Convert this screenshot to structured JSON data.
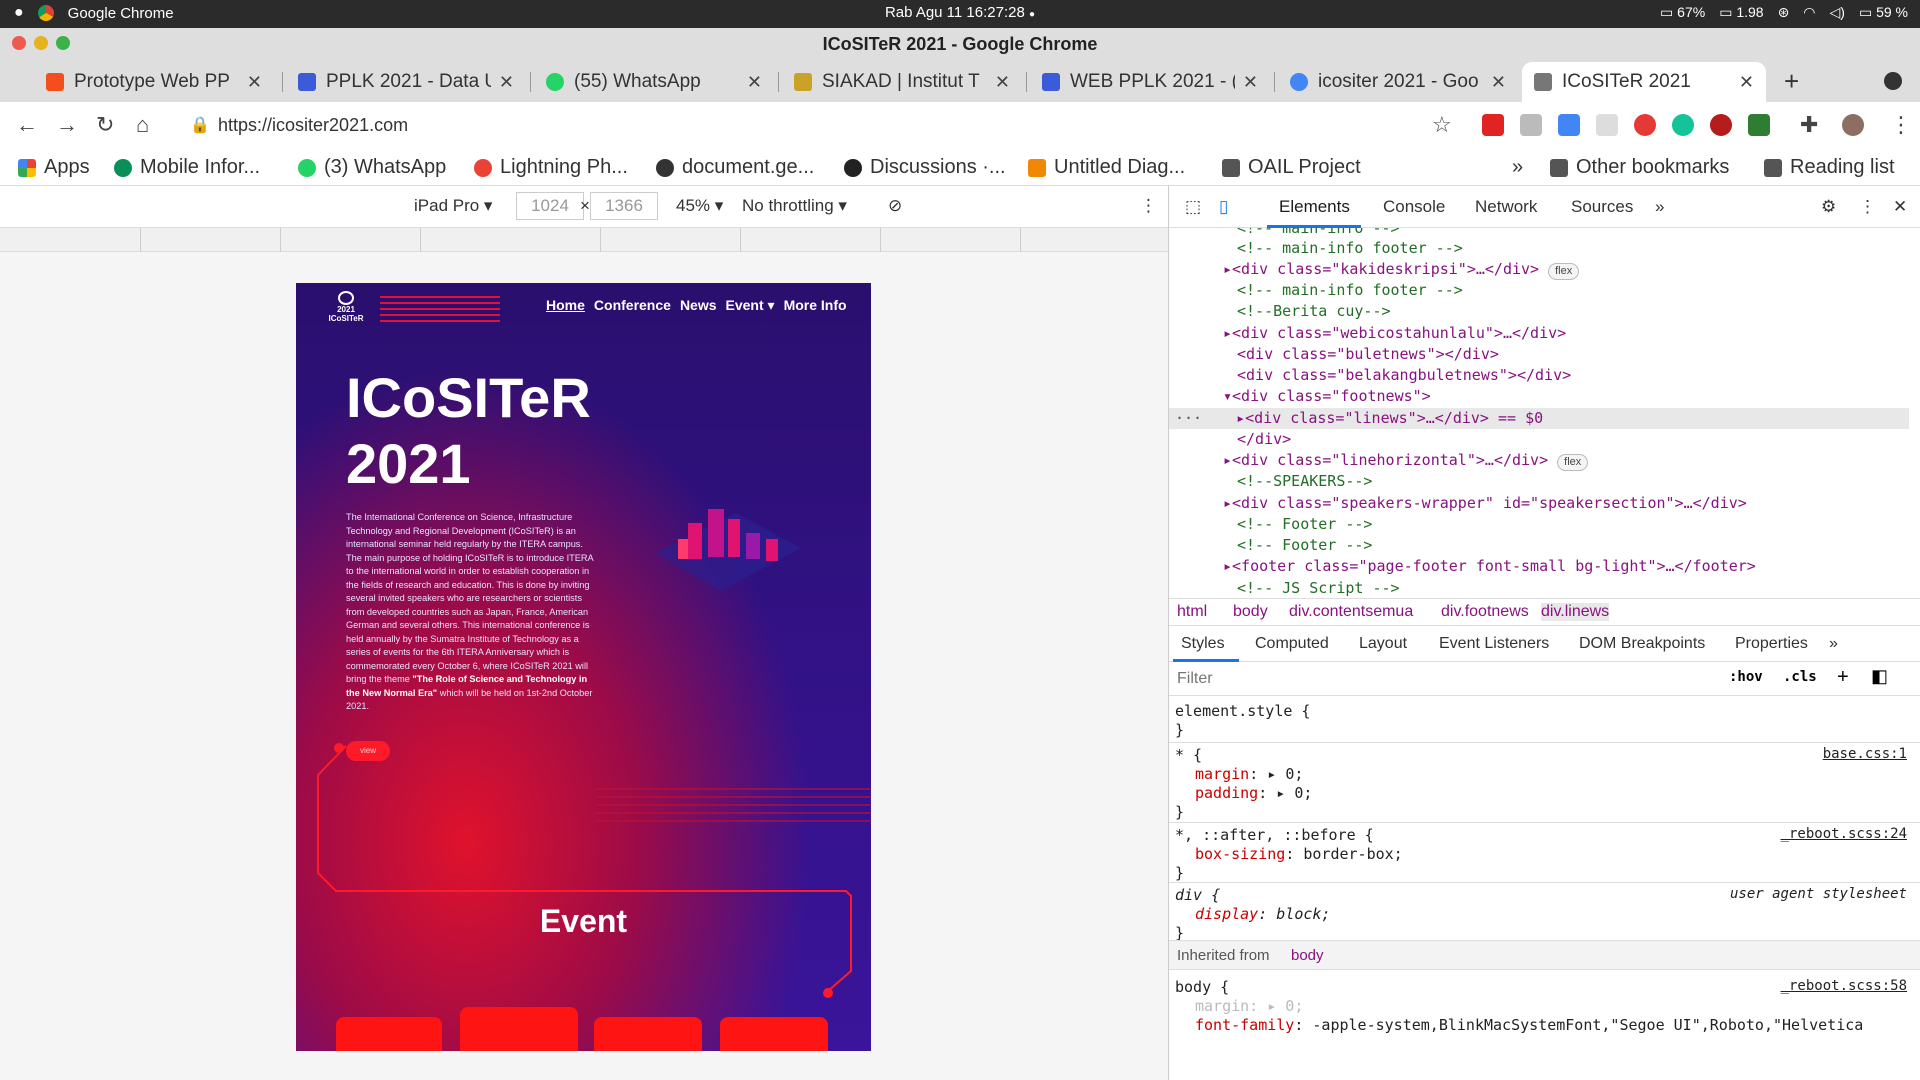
{
  "topbar": {
    "apple": "",
    "app": "Google Chrome",
    "datetime": "Rab Agu 11  16:27:28",
    "cpu": "67%",
    "load": "1.98",
    "battery": "59 %"
  },
  "window": {
    "title": "ICoSITeR 2021 - Google Chrome"
  },
  "tabs": [
    {
      "title": "Prototype Web PP",
      "color": "#f24e1e"
    },
    {
      "title": "PPLK 2021 - Data U",
      "color": "#3b5bdb"
    },
    {
      "title": "(55) WhatsApp",
      "color": "#25d366"
    },
    {
      "title": "SIAKAD | Institut T",
      "color": "#c9a227"
    },
    {
      "title": "WEB PPLK 2021 - (",
      "color": "#3b5bdb"
    },
    {
      "title": "icositer 2021 - Goo",
      "color": "#4285f4"
    },
    {
      "title": "ICoSITeR 2021",
      "color": "#777777"
    }
  ],
  "address": {
    "url": "https://icositer2021.com"
  },
  "bookmarks": [
    {
      "label": "Apps"
    },
    {
      "label": "Mobile Infor..."
    },
    {
      "label": "(3) WhatsApp"
    },
    {
      "label": "Lightning Ph..."
    },
    {
      "label": "document.ge..."
    },
    {
      "label": "Discussions ·..."
    },
    {
      "label": "Untitled Diag..."
    },
    {
      "label": "OAIL Project"
    },
    {
      "label": "»"
    },
    {
      "label": "Other bookmarks"
    },
    {
      "label": "Reading list"
    }
  ],
  "devicebar": {
    "device": "iPad Pro ▾",
    "width": "1024",
    "height": "1366",
    "zoom": "45% ▾",
    "throttle": "No throttling ▾"
  },
  "site": {
    "logo": "2021 ICoSITeR",
    "nav": [
      "Home",
      "Conference",
      "News",
      "Event ▾",
      "More Info"
    ],
    "hero1": "ICoSITeR",
    "hero2": "2021",
    "description": "The International Conference on Science, Infrastructure Technology and Regional Development (ICoSITeR) is an international seminar held regularly by the ITERA campus. The main purpose of holding ICoSITeR is to introduce ITERA to the international world in order to establish cooperation in the fields of research and education. This is done by inviting several invited speakers who are researchers or scientists from developed countries such as Japan, France, American German and several others. This international conference is held annually by the Sumatra Institute of Technology as a series of events for the 6th ITERA Anniversary which is commemorated every October 6, where ICoSITeR 2021 will bring the theme",
    "theme": "\"The Role of Science and Technology in the New Normal Era\"",
    "dates": "which will be held on 1st-2nd October 2021.",
    "view": "view",
    "event": "Event"
  },
  "devtools": {
    "tabs": [
      "Elements",
      "Console",
      "Network",
      "Sources",
      "»"
    ],
    "dom": [
      "<!-- main-info -->",
      "<!-- main-info footer -->",
      "<div class=\"kakideskripsi\">…</div>",
      "<!-- main-info footer -->",
      "<!--Berita cuy-->",
      "<div class=\"webicostahunlalu\">…</div>",
      "<div class=\"buletnews\"></div>",
      "<div class=\"belakangbuletnews\"></div>",
      "<div class=\"footnews\">",
      "<div class=\"linews\">…</div> == $0",
      "</div>",
      "<div class=\"linehorizontal\">…</div>",
      "<!--SPEAKERS-->",
      "<div class=\"speakers-wrapper\" id=\"speakersection\">…</div>",
      "<!-- Footer -->",
      "<!-- Footer -->",
      "<footer class=\"page-footer font-small bg-light\">…</footer>",
      "<!-- JS Script -->"
    ],
    "badge": "flex",
    "crumbs": [
      "html",
      "body",
      "div.contentsemua",
      "div.footnews",
      "div.linews"
    ],
    "subtabs": [
      "Styles",
      "Computed",
      "Layout",
      "Event Listeners",
      "DOM Breakpoints",
      "Properties",
      "»"
    ],
    "filter_placeholder": "Filter",
    "hov": ":hov",
    "cls": ".cls",
    "styles": {
      "element": "element.style {",
      "close": "}",
      "star_sel": "* {",
      "star_src": "base.css:1",
      "margin": "margin",
      "margin_val": "0;",
      "padding": "padding",
      "padding_val": "0;",
      "after_sel": "*, ::after, ::before {",
      "after_src": "_reboot.scss:24",
      "boxsizing": "box-sizing",
      "boxsizing_val": "border-box;",
      "div_sel": "div {",
      "div_src": "user agent stylesheet",
      "display": "display",
      "display_val": "block;",
      "inherited": "Inherited from",
      "inherited_el": "body",
      "body_sel": "body {",
      "body_src": "_reboot.scss:58",
      "body_margin": "margin: ▸ 0;",
      "fontfamily": "font-family",
      "fontfamily_val": "-apple-system,BlinkMacSystemFont,\"Segoe UI\",Roboto,\"Helvetica"
    }
  }
}
